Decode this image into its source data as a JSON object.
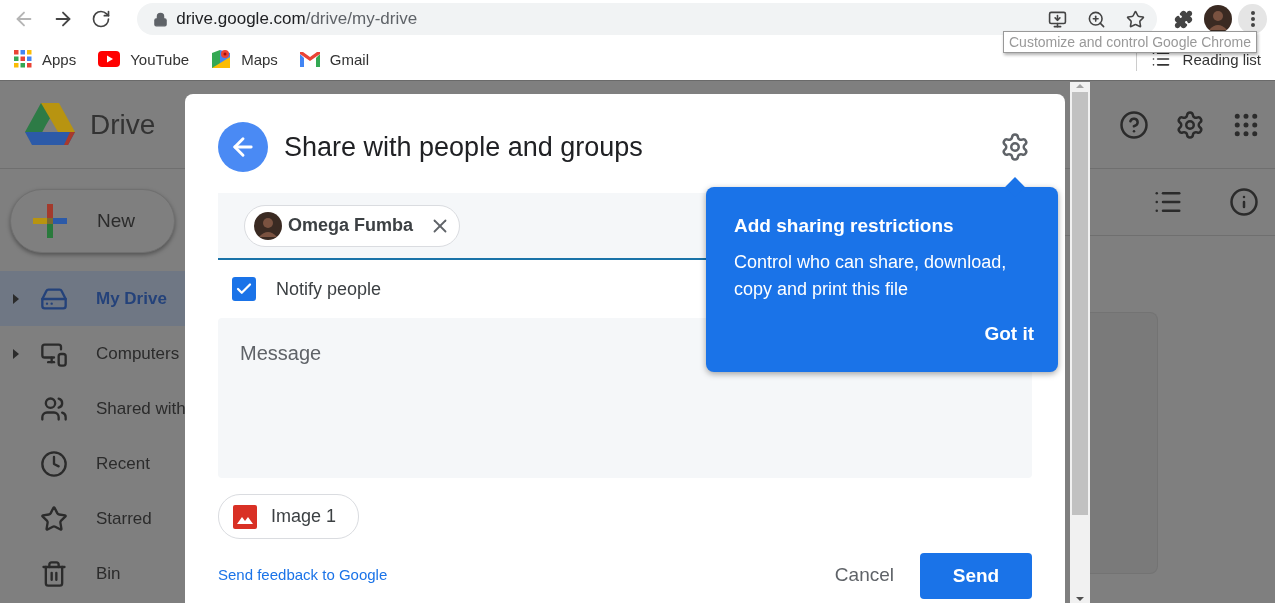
{
  "browser": {
    "back_disabled": true,
    "address": {
      "host": "drive.google.com",
      "path": "/drive/my-drive"
    },
    "bookmarks": [
      {
        "label": "Apps"
      },
      {
        "label": "YouTube"
      },
      {
        "label": "Maps"
      },
      {
        "label": "Gmail"
      }
    ],
    "reading_list": "Reading list",
    "tooltip": "Customize and control Google Chrome"
  },
  "drive": {
    "title": "Drive",
    "new_button": "New",
    "sidebar": [
      {
        "label": "My Drive",
        "selected": true,
        "expandable": true
      },
      {
        "label": "Computers",
        "selected": false,
        "expandable": true
      },
      {
        "label": "Shared with",
        "selected": false,
        "expandable": false
      },
      {
        "label": "Recent",
        "selected": false,
        "expandable": false
      },
      {
        "label": "Starred",
        "selected": false,
        "expandable": false
      },
      {
        "label": "Bin",
        "selected": false,
        "expandable": false
      }
    ]
  },
  "dialog": {
    "title": "Share with people and groups",
    "recipients": [
      {
        "name": "Omega Fumba"
      }
    ],
    "notify": {
      "label": "Notify people",
      "checked": true
    },
    "message": {
      "placeholder": "Message"
    },
    "attachments": [
      {
        "name": "Image 1"
      }
    ],
    "feedback_link": "Send feedback to Google",
    "buttons": {
      "cancel": "Cancel",
      "send": "Send"
    }
  },
  "popup": {
    "title": "Add sharing restrictions",
    "body": "Control who can share, download, copy and print this file",
    "action": "Got it"
  }
}
